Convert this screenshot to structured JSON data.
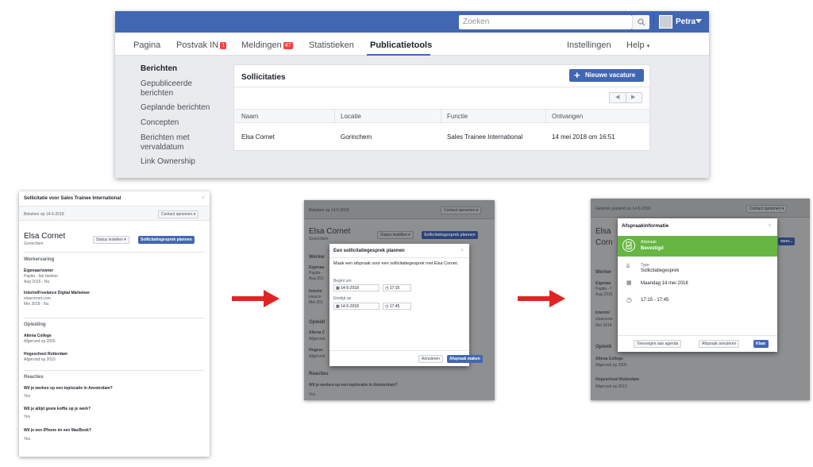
{
  "top": {
    "search_placeholder": "Zoeken",
    "user_name": "Petra",
    "nav": [
      "Pagina",
      "Postvak IN",
      "Meldingen",
      "Statistieken",
      "Publicatietools",
      "Instellingen",
      "Help"
    ],
    "badge_inbox": "1",
    "badge_notifications": "47",
    "help_caret": "▾",
    "sidebar": [
      "Berichten",
      "Gepubliceerde berichten",
      "Geplande berichten",
      "Concepten",
      "Berichten met vervaldatum",
      "Link Ownership"
    ],
    "card_title": "Sollicitaties",
    "new_button": "Nieuwe vacature",
    "columns": [
      "Naam",
      "Locatie",
      "Functie",
      "Ontvangen"
    ],
    "row": [
      "Elsa Cornet",
      "Gorinchem",
      "Sales Trainee International",
      "14 mei 2018 om 16:51"
    ]
  },
  "panel1": {
    "title": "Sollicitatie voor Sales Trainee International",
    "viewed": "Bekeken op 14-5-2018",
    "contact": "Contact opnemen ▾",
    "name": "Elsa Cornet",
    "location": "Gorinchem",
    "status_btn": "Status instellen ▾",
    "plan_btn": "Sollicitatiegesprek plannen",
    "sec_work": "Werkervaring",
    "job1_title": "Eigenaar/owner",
    "job1_org": "Papita - fair fashion",
    "job1_dates": "Aug 2016 - Nu",
    "job2_title": "Interim/Freelance Digital Marketeer",
    "job2_org": "elsacornet.com",
    "job2_dates": "Mei 2018 - Nu",
    "sec_edu": "Opleiding",
    "edu1": "Altena College",
    "edu1_date": "Afgerond op 2005",
    "edu2": "Hogeschool Rotterdam",
    "edu2_date": "Afgerond op 2010",
    "sec_reac": "Reacties",
    "q1": "Wil je werken op een toplocatie in Amsterdam?",
    "q2": "Wil je altijd goeie koffie op je werk?",
    "q3": "Wil je een iPhone én een MacBook?",
    "yes": "Yes"
  },
  "panel2": {
    "viewed": "Bekeken op 14-5-2018",
    "contact": "Contact opnemen ▾",
    "name": "Elsa Cornet",
    "location": "Gorinchem",
    "status_btn": "Status instellen ▾",
    "plan_btn": "Sollicitatiegesprek plannen",
    "bg_work": "Werker",
    "bg_job1": "Eigenaa",
    "bg_job1b": "Papita -",
    "bg_job1c": "Aug 201",
    "bg_job2": "Interim",
    "bg_job2b": "elsacor",
    "bg_job2c": "Mei 201",
    "bg_edu": "Opleidi",
    "bg_edu1": "Altena C",
    "bg_edu1b": "Afgerond",
    "bg_edu2": "Hogesc",
    "bg_edu2b": "Afgerond",
    "bg_reac": "Reacties",
    "bg_q1": "Wil je werken op een toplocatie in Amsterdam?",
    "bg_yes": "Yes",
    "dialog_title": "Een sollicitatiegesprek plannen",
    "dialog_text": "Maak een afspraak voor een sollicitatiegesprek met Elsa Cornet.",
    "begins": "Begint om",
    "ends": "Eindigt op",
    "date1": "14-5-2018",
    "time1": "17:15",
    "date2": "14-5-2018",
    "time2": "17:45",
    "cancel": "Annuleren",
    "make": "Afspraak maken"
  },
  "panel3": {
    "header": "Gesprek gepland op 14-5-2018",
    "contact": "Contact opnemen ▾",
    "bg_name1": "Elsa",
    "bg_name2": "Corn",
    "bg_btn": "weer...",
    "bg_work": "Werker",
    "bg_job1": "Eigenaa",
    "bg_job1b": "Papita - f",
    "bg_job1c": "Aug 2016",
    "bg_job2": "Interim/",
    "bg_job2b": "elsacorne",
    "bg_job2c": "Mei 2018",
    "bg_edu": "Opleidi",
    "bg_edu1": "Altena College",
    "bg_edu1b": "Afgerond op 2005",
    "bg_edu2": "Hogeschool Rotterdam",
    "bg_edu2b": "Afgerond op 2010",
    "dialog_title": "Afspraakinformatie",
    "status_label": "Afspraak",
    "status_value": "Bevestigd",
    "type_label": "Type",
    "type_value": "Sollicitatiegesprek",
    "date_value": "Maandag 14 mei 2018",
    "time_value": "17:15 - 17:45",
    "btn_agenda": "Toevoegen aan agenda",
    "btn_cancel": "Afspraak annuleren",
    "btn_done": "Klaar"
  }
}
